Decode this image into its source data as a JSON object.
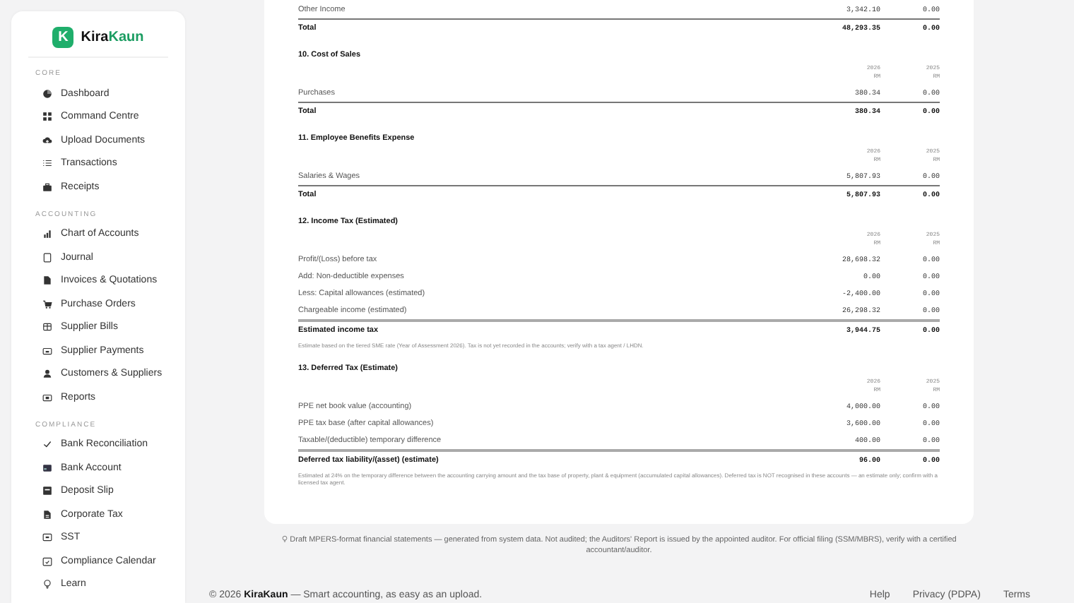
{
  "sidebar": {
    "brand": {
      "mark": "K",
      "name_start": "Kira",
      "name_end": "Kaun"
    },
    "groups": [
      {
        "label": "CORE",
        "items": [
          "Dashboard",
          "Command Centre",
          "Upload Documents",
          "Transactions",
          "Receipts"
        ]
      },
      {
        "label": "ACCOUNTING",
        "items": [
          "Chart of Accounts",
          "Journal",
          "Invoices & Quotations",
          "Purchase Orders",
          "Supplier Bills",
          "Supplier Payments",
          "Customers & Suppliers",
          "Reports"
        ]
      },
      {
        "label": "COMPLIANCE",
        "items": [
          "Bank Reconciliation",
          "Bank Account",
          "Deposit Slip",
          "Corporate Tax",
          "SST",
          "Compliance Calendar",
          "Learn"
        ]
      }
    ]
  },
  "statement": {
    "sections": [
      {
        "rows": [
          {
            "kind": "line",
            "label": "Other Income",
            "current": "3,342.10",
            "prior": "0.00"
          },
          {
            "kind": "total",
            "label": "Total",
            "current": "48,293.35",
            "prior": "0.00"
          }
        ]
      },
      {
        "heading": "10. Cost of Sales",
        "columns": [
          {
            "year": "2026",
            "unit": "RM"
          },
          {
            "year": "2025",
            "unit": "RM"
          }
        ],
        "rows": [
          {
            "kind": "line",
            "label": "Purchases",
            "current": "380.34",
            "prior": "0.00"
          },
          {
            "kind": "total",
            "label": "Total",
            "current": "380.34",
            "prior": "0.00"
          }
        ]
      },
      {
        "heading": "11. Employee Benefits Expense",
        "columns": [
          {
            "year": "2026",
            "unit": "RM"
          },
          {
            "year": "2025",
            "unit": "RM"
          }
        ],
        "rows": [
          {
            "kind": "line",
            "label": "Salaries & Wages",
            "current": "5,807.93",
            "prior": "0.00"
          },
          {
            "kind": "total",
            "label": "Total",
            "current": "5,807.93",
            "prior": "0.00"
          }
        ]
      },
      {
        "heading": "12. Income Tax (Estimated)",
        "columns": [
          {
            "year": "2026",
            "unit": "RM"
          },
          {
            "year": "2025",
            "unit": "RM"
          }
        ],
        "rows": [
          {
            "kind": "line",
            "label": "Profit/(Loss) before tax",
            "current": "28,698.32",
            "prior": "0.00"
          },
          {
            "kind": "line",
            "label": "Add: Non-deductible expenses",
            "current": "0.00",
            "prior": "0.00"
          },
          {
            "kind": "line",
            "label": "Less: Capital allowances (estimated)",
            "current": "-2,400.00",
            "prior": "0.00"
          },
          {
            "kind": "line",
            "label": "Chargeable income (estimated)",
            "current": "26,298.32",
            "prior": "0.00"
          },
          {
            "kind": "result",
            "label": "Estimated income tax",
            "current": "3,944.75",
            "prior": "0.00"
          }
        ],
        "note": "Estimate based on the tiered SME rate (Year of Assessment 2026). Tax is not yet recorded in the accounts; verify with a tax agent / LHDN."
      },
      {
        "heading": "13. Deferred Tax (Estimate)",
        "columns": [
          {
            "year": "2026",
            "unit": "RM"
          },
          {
            "year": "2025",
            "unit": "RM"
          }
        ],
        "rows": [
          {
            "kind": "line",
            "label": "PPE net book value (accounting)",
            "current": "4,000.00",
            "prior": "0.00"
          },
          {
            "kind": "line",
            "label": "PPE tax base (after capital allowances)",
            "current": "3,600.00",
            "prior": "0.00"
          },
          {
            "kind": "line",
            "label": "Taxable/(deductible) temporary difference",
            "current": "400.00",
            "prior": "0.00"
          },
          {
            "kind": "result",
            "label": "Deferred tax liability/(asset) (estimate)",
            "current": "96.00",
            "prior": "0.00"
          }
        ],
        "note": "Estimated at 24% on the temporary difference between the accounting carrying amount and the tax base of property, plant & equipment (accumulated capital allowances). Deferred tax is NOT recognised in these accounts — an estimate only; confirm with a licensed tax agent."
      }
    ]
  },
  "disclaimer": "Draft MPERS-format financial statements — generated from system data. Not audited; the Auditors' Report is issued by the appointed auditor. For official filing (SSM/MBRS), verify with a certified accountant/auditor.",
  "footer": {
    "copyright": "© 2026 **KiraKaun** — Smart accounting, as easy as an upload.",
    "links": [
      "Help",
      "Privacy (PDPA)",
      "Terms"
    ]
  }
}
